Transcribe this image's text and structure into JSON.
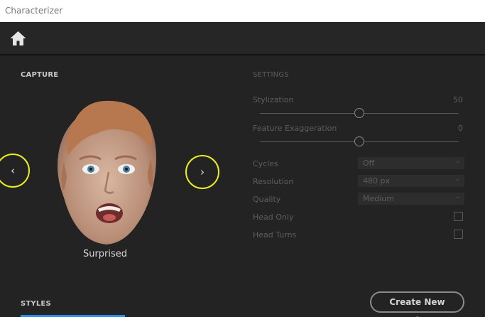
{
  "window": {
    "title": "Characterizer"
  },
  "capture": {
    "heading": "CAPTURE",
    "expression_label": "Surprised",
    "prev_glyph": "‹",
    "next_glyph": "›"
  },
  "settings": {
    "heading": "SETTINGS",
    "stylization": {
      "label": "Stylization",
      "value": "50",
      "fraction": 0.5
    },
    "feature_exaggeration": {
      "label": "Feature Exaggeration",
      "value": "0",
      "fraction": 0.5
    },
    "cycles": {
      "label": "Cycles",
      "selected": "Off"
    },
    "resolution": {
      "label": "Resolution",
      "selected": "480 px"
    },
    "quality": {
      "label": "Quality",
      "selected": "Medium"
    },
    "head_only": {
      "label": "Head Only",
      "checked": false
    },
    "head_turns": {
      "label": "Head Turns",
      "checked": false
    }
  },
  "styles": {
    "heading": "STYLES",
    "create_button": "Create New Style..."
  },
  "colors": {
    "highlight_circle": "#ecec22",
    "tab_accent": "#2d8ceb",
    "background": "#232323"
  }
}
